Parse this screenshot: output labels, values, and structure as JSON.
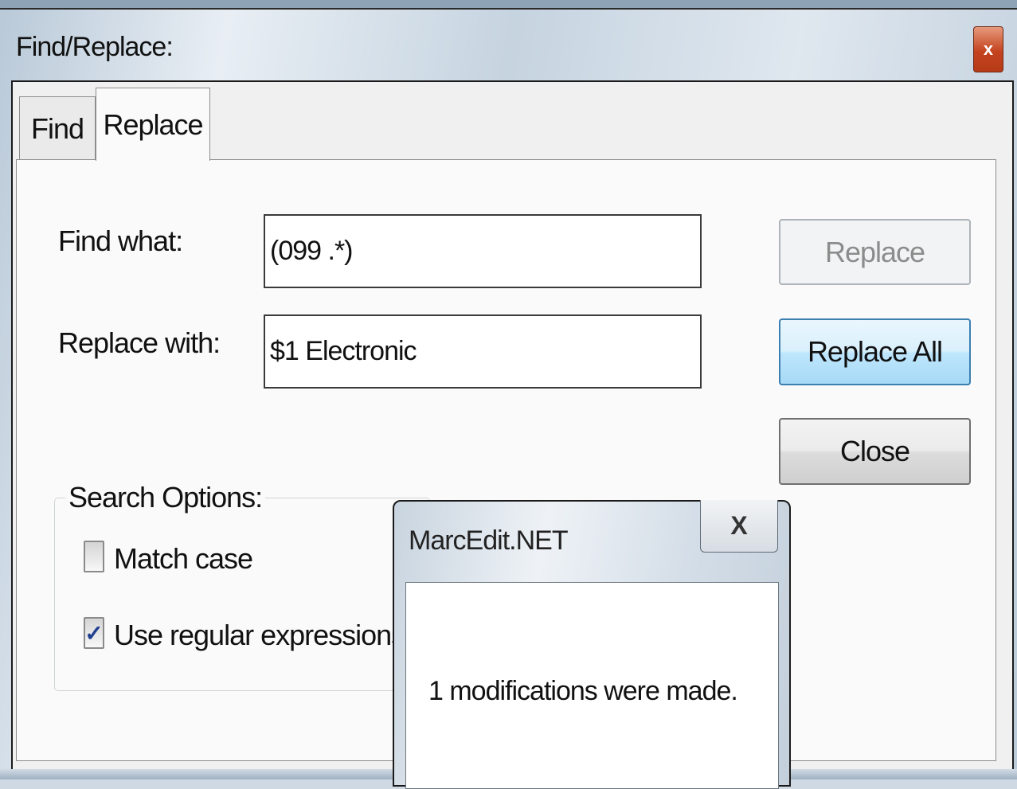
{
  "window": {
    "title": "Find/Replace:",
    "close_glyph": "x"
  },
  "tabs": [
    {
      "label": "Find",
      "active": false
    },
    {
      "label": "Replace",
      "active": true
    }
  ],
  "form": {
    "find_label": "Find what:",
    "find_value": "(099 .*)",
    "replace_label": "Replace with:",
    "replace_value": "$1 Electronic"
  },
  "buttons": {
    "replace": "Replace",
    "replace_all": "Replace All",
    "close": "Close"
  },
  "search_options": {
    "legend": "Search Options:",
    "match_case": {
      "label": "Match case",
      "checked": false
    },
    "use_regex": {
      "label": "Use regular expressions",
      "checked": true,
      "check_glyph": "✓"
    }
  },
  "message_box": {
    "title": "MarcEdit.NET",
    "close_glyph": "X",
    "message": "1 modifications were made."
  }
}
